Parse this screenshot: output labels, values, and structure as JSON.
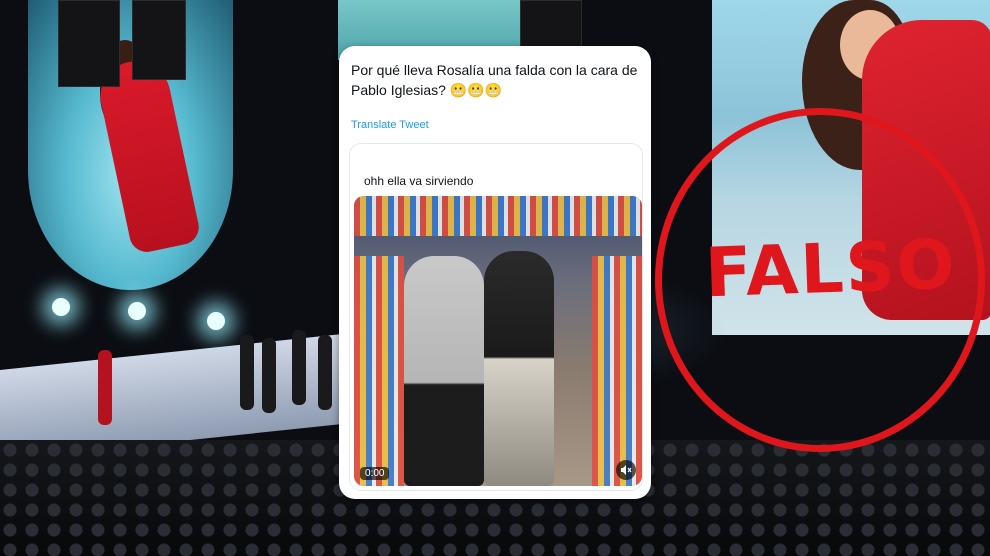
{
  "tweet": {
    "text": "Por qué lleva Rosalía una falda con la cara de Pablo Iglesias? 😬😬😬",
    "translate_label": "Translate Tweet"
  },
  "quoted_tweet": {
    "text": "ohh ella va sirviendo",
    "video_duration": "0:00"
  },
  "stamp": {
    "label": "FALSO",
    "color": "#e0161d"
  },
  "icons": {
    "mute": "speaker-muted-icon"
  },
  "colors": {
    "link": "#1d9bf0",
    "card_bg": "#ffffff"
  }
}
